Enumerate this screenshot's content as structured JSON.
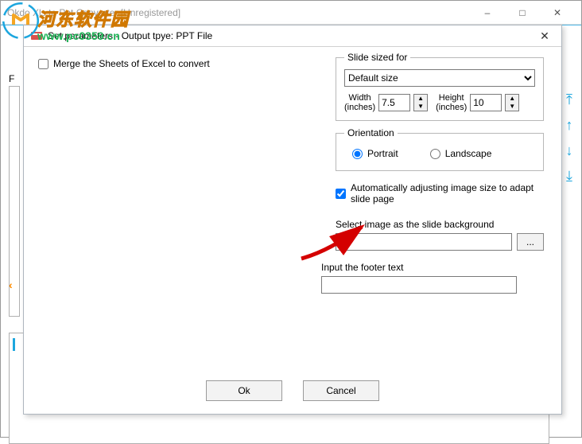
{
  "parent": {
    "title": "Okdo Xls to Ppt Converter [Unregistered]",
    "side_labels": [
      "↑",
      "↑",
      "↓",
      "↓"
    ],
    "f_label": "F"
  },
  "watermark": {
    "cn": "河东软件园",
    "url": "www.pc0359.cn"
  },
  "dialog": {
    "title": "Set parameters - Output tpye: PPT File",
    "merge_label": "Merge the Sheets of Excel to convert",
    "merge_checked": false,
    "slide_sized": {
      "legend": "Slide sized for",
      "selected": "Default size",
      "width_label_top": "Width",
      "width_label_bottom": "(inches)",
      "width_value": "7.5",
      "height_label_top": "Height",
      "height_label_bottom": "(inches)",
      "height_value": "10"
    },
    "orientation": {
      "legend": "Orientation",
      "portrait": "Portrait",
      "landscape": "Landscape",
      "selected": "portrait"
    },
    "auto_adjust": {
      "checked": true,
      "label": "Automatically adjusting image size to adapt slide page"
    },
    "sel_image": {
      "label": "Select image as the slide background",
      "value": "",
      "browse": "..."
    },
    "footer": {
      "label": "Input the footer text",
      "value": ""
    },
    "buttons": {
      "ok": "Ok",
      "cancel": "Cancel"
    }
  }
}
